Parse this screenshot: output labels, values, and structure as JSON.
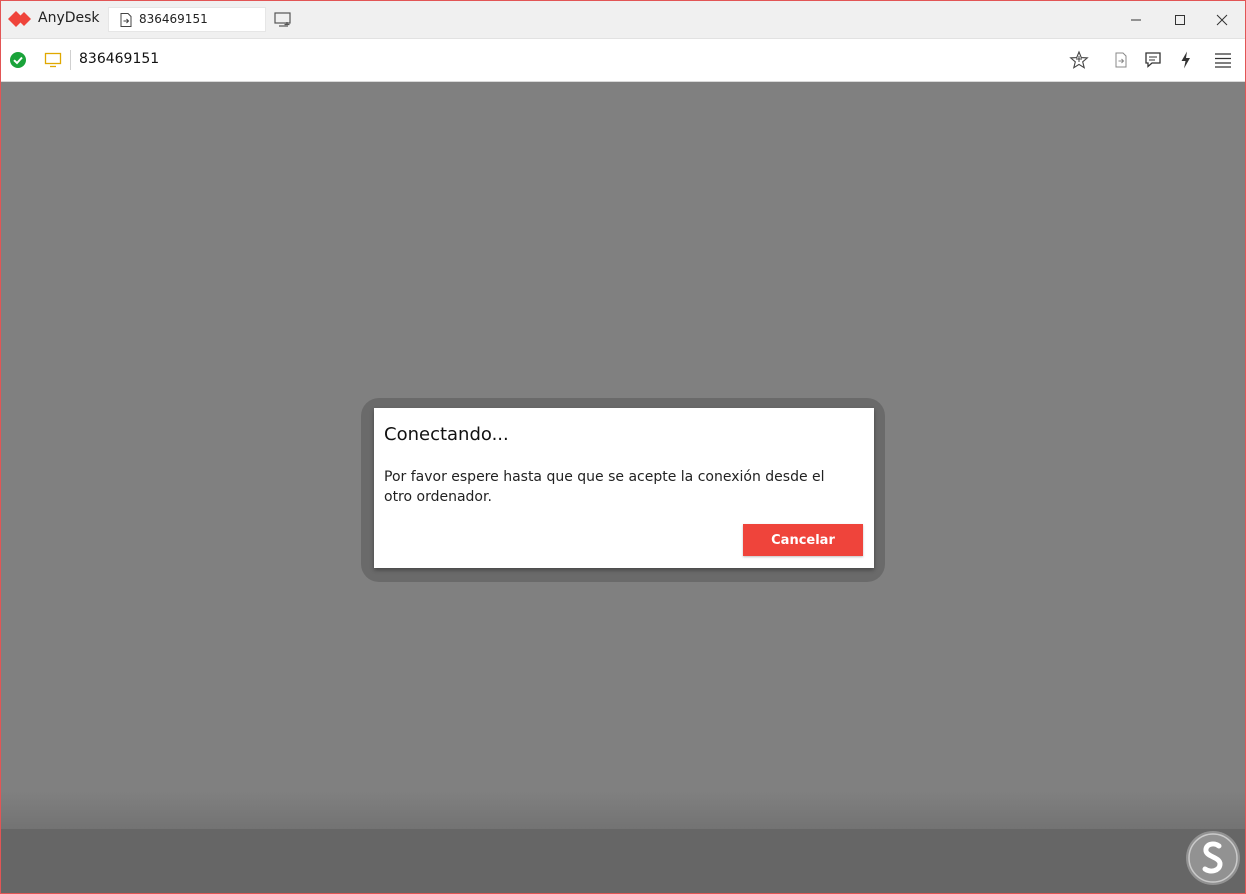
{
  "app": {
    "name": "AnyDesk"
  },
  "tab": {
    "label": "836469151"
  },
  "toolbar": {
    "address": "836469151",
    "status": "connected",
    "icons": [
      "check-circle-icon",
      "monitor-icon",
      "star-icon",
      "file-transfer-icon",
      "chat-icon",
      "lightning-icon",
      "menu-icon"
    ]
  },
  "window_controls": [
    "minimize",
    "maximize",
    "close"
  ],
  "dialog": {
    "title": "Conectando...",
    "message": "Por favor espere hasta que que se acepte la conexión desde el otro ordenador.",
    "cancel_label": "Cancelar"
  },
  "colors": {
    "accent": "#ef443b",
    "status_ok": "#1aa33a",
    "monitor": "#e0a800",
    "backdrop": "#808080"
  }
}
